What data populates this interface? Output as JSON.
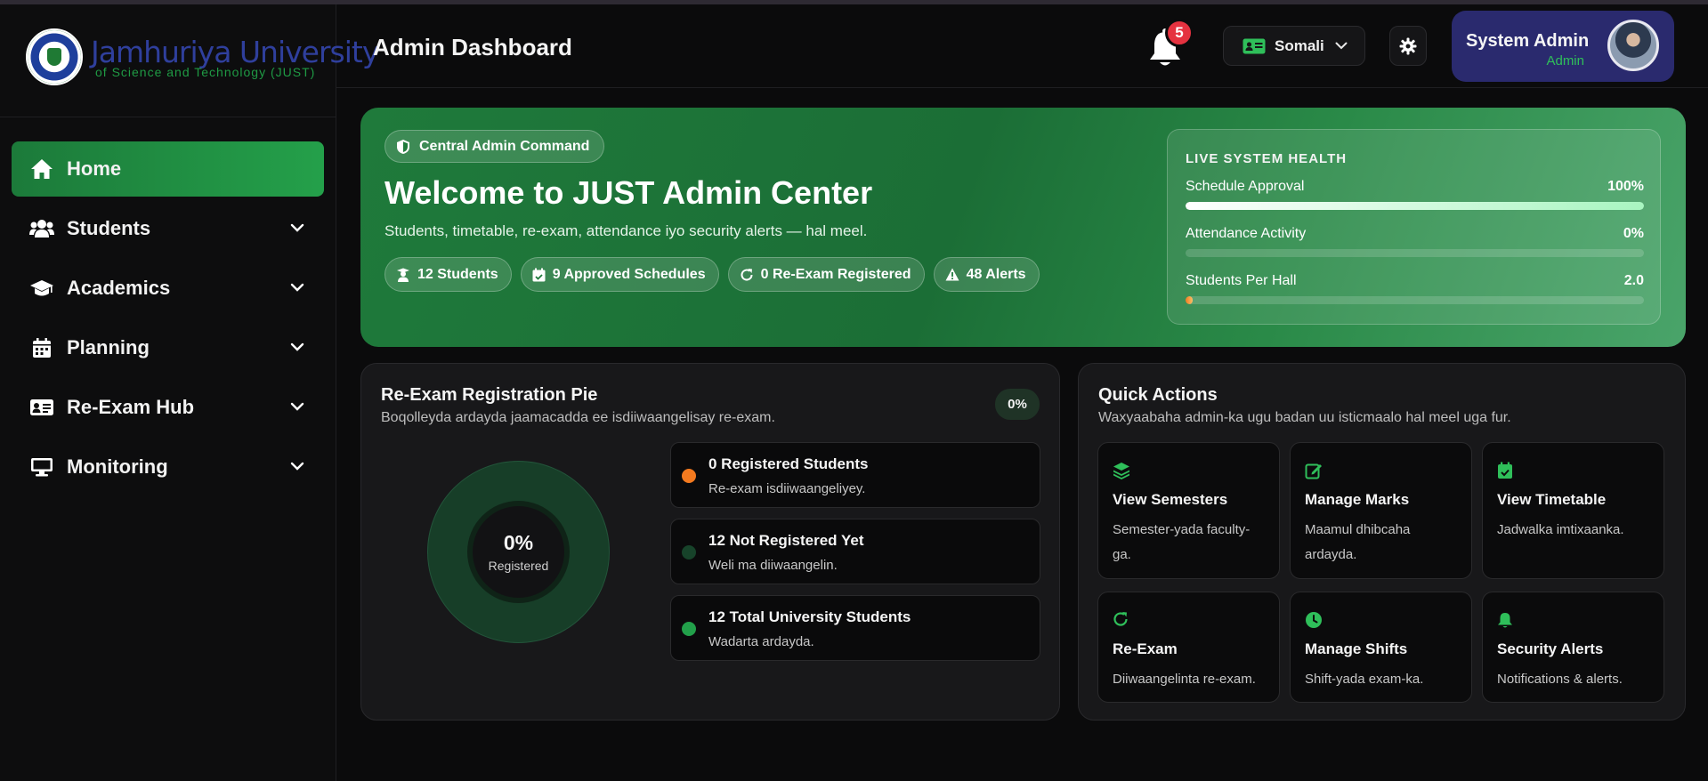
{
  "brand": {
    "name": "Jamhuriya University",
    "subtitle": "of Science and Technology (JUST)"
  },
  "sidebar": {
    "items": [
      {
        "label": "Home",
        "icon": "home-icon",
        "active": true
      },
      {
        "label": "Students",
        "icon": "users-icon"
      },
      {
        "label": "Academics",
        "icon": "graduation-cap-icon"
      },
      {
        "label": "Planning",
        "icon": "calendar-icon"
      },
      {
        "label": "Re-Exam Hub",
        "icon": "id-card-icon"
      },
      {
        "label": "Monitoring",
        "icon": "monitor-icon"
      }
    ]
  },
  "header": {
    "title": "Admin Dashboard",
    "notifications_count": "5",
    "language": "Somali",
    "user_name": "System Admin",
    "user_role": "Admin"
  },
  "hero": {
    "badge": "Central Admin Command",
    "title": "Welcome to JUST Admin Center",
    "subtitle": "Students, timetable, re-exam, attendance iyo security alerts — hal meel.",
    "stats": [
      {
        "label": "12 Students",
        "icon": "student-icon"
      },
      {
        "label": "9 Approved Schedules",
        "icon": "calendar-check-icon"
      },
      {
        "label": "0 Re-Exam Registered",
        "icon": "refresh-icon"
      },
      {
        "label": "48 Alerts",
        "icon": "warning-icon"
      }
    ],
    "health": {
      "title": "LIVE SYSTEM HEALTH",
      "metrics": [
        {
          "label": "Schedule Approval",
          "value": "100%",
          "fraction": 1.0
        },
        {
          "label": "Attendance Activity",
          "value": "0%",
          "fraction": 0.0
        },
        {
          "label": "Students Per Hall",
          "value": "2.0",
          "fraction": 0.01
        }
      ]
    }
  },
  "reexam_card": {
    "title": "Re-Exam Registration Pie",
    "subtitle": "Boqolleyda ardayda jaamacadda ee isdiiwaangelisay re-exam.",
    "badge": "0%",
    "center_value": "0%",
    "center_label": "Registered",
    "legend": [
      {
        "title": "0 Registered Students",
        "desc": "Re-exam isdiiwaangeliyey.",
        "color": "#f47a1f"
      },
      {
        "title": "12 Not Registered Yet",
        "desc": "Weli ma diiwaangelin.",
        "color": "#17432a"
      },
      {
        "title": "12 Total University Students",
        "desc": "Wadarta ardayda.",
        "color": "#22a04a"
      }
    ]
  },
  "quick_actions": {
    "title": "Quick Actions",
    "subtitle": "Waxyaabaha admin-ka ugu badan uu isticmaalo hal meel uga fur.",
    "items": [
      {
        "title": "View Semesters",
        "desc": "Semester-yada faculty-ga.",
        "icon": "layers-icon"
      },
      {
        "title": "Manage Marks",
        "desc": "Maamul dhibcaha ardayda.",
        "icon": "edit-icon"
      },
      {
        "title": "View Timetable",
        "desc": "Jadwalka imtixaanka.",
        "icon": "calendar-check-icon"
      },
      {
        "title": "Re-Exam",
        "desc": "Diiwaangelinta re-exam.",
        "icon": "refresh-icon"
      },
      {
        "title": "Manage Shifts",
        "desc": "Shift-yada exam-ka.",
        "icon": "clock-icon"
      },
      {
        "title": "Security Alerts",
        "desc": "Notifications & alerts.",
        "icon": "bell-icon"
      }
    ]
  },
  "colors": {
    "accent_green": "#22a04a",
    "profile_bg": "#2a2a6e",
    "badge_red": "#e53240"
  }
}
